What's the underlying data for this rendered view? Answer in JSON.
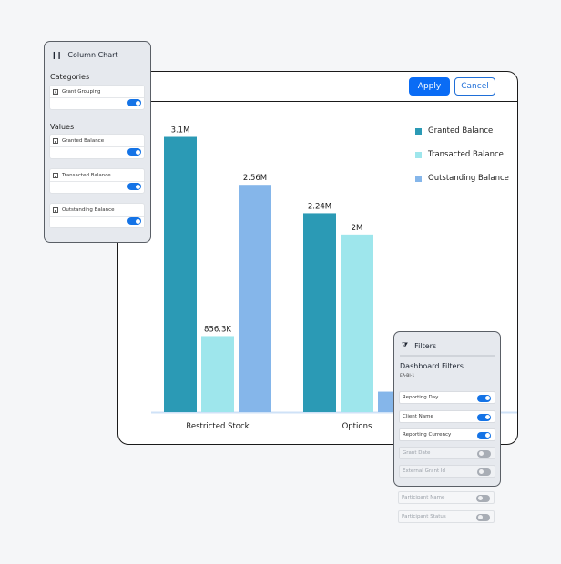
{
  "main": {
    "apply_label": "Apply",
    "cancel_label": "Cancel"
  },
  "chart_data": {
    "type": "bar",
    "categories": [
      "Restricted Stock",
      "Options"
    ],
    "series": [
      {
        "name": "Granted Balance",
        "color": "#2b9ab5",
        "values": [
          3100000,
          2240000
        ],
        "labels": [
          "3.1M",
          "2.24M"
        ]
      },
      {
        "name": "Transacted Balance",
        "color": "#9ee6ec",
        "values": [
          856300,
          2000000
        ],
        "labels": [
          "856.3K",
          "2M"
        ]
      },
      {
        "name": "Outstanding Balance",
        "color": "#85b6ea",
        "values": [
          2560000,
          230000
        ],
        "labels": [
          "2.56M",
          ""
        ]
      }
    ],
    "title": "",
    "xlabel": "",
    "ylabel": "",
    "ylim": [
      0,
      3300000
    ],
    "grid": false,
    "legend": "top-right",
    "axis_color": "#cfe2f7"
  },
  "column_chart_panel": {
    "title": "Column Chart",
    "icon": "bar-chart-icon",
    "categories_label": "Categories",
    "categories": [
      {
        "label": "Grant Grouping",
        "icon": "text-field-icon",
        "enabled": true
      }
    ],
    "values_label": "Values",
    "values": [
      {
        "label": "Granted Balance",
        "icon": "numeric-field-icon",
        "enabled": true
      },
      {
        "label": "Transacted Balance",
        "icon": "numeric-field-icon",
        "enabled": true
      },
      {
        "label": "Outstanding Balance",
        "icon": "numeric-field-icon",
        "enabled": true
      }
    ]
  },
  "filters_panel": {
    "title": "Filters",
    "icon": "funnel-icon",
    "heading": "Dashboard Filters",
    "code": "EA-BI-1",
    "rows": [
      {
        "label": "Reporting Day",
        "enabled": true
      },
      {
        "label": "Client Name",
        "enabled": true
      },
      {
        "label": "Reporting Currency",
        "enabled": true
      },
      {
        "label": "Grant Date",
        "enabled": false
      },
      {
        "label": "External Grant Id",
        "enabled": false
      },
      {
        "label": "Participant Name",
        "enabled": false
      },
      {
        "label": "Participant Status",
        "enabled": false
      }
    ]
  }
}
